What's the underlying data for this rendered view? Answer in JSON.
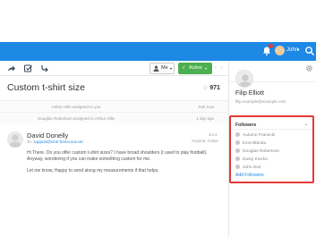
{
  "topbar": {
    "user_name": "John",
    "caret": "▾",
    "icons": [
      "bell-icon",
      "avatar",
      "search-icon"
    ],
    "accent": "#1e88e5"
  },
  "toolbar": {
    "icons": [
      "share-arrow-icon",
      "checkbox-icon",
      "merge-icon"
    ],
    "assignee_label": "Me",
    "assignee_caret": "▾",
    "status_label": "Active",
    "status_check": "✓",
    "status_caret": "▾",
    "status_color": "#4caf50",
    "nav_arrows": "‹ ›"
  },
  "ticket": {
    "title": "Custom t-shirt size",
    "rating_star": "☆",
    "rating_value": "971"
  },
  "events": [
    {
      "text": "Arthur Hills assigned to you",
      "time": "Just now"
    },
    {
      "text": "Douglas Robertson assigned to Arthur Hills",
      "time": "1 day ago"
    }
  ],
  "message": {
    "sender": "David Donelly",
    "to_prefix": "To: ",
    "to_address": "support@smtr.freescout.net",
    "date": "Jul 4",
    "status": "Anyone: Active",
    "body_lines": [
      "Hi There. Do you offer custom t-shirt sizes? I have broad shoulders (I used to play football).",
      "Anyway, wondering if you can make something custom for me.",
      "Let me know, Happy to send along my measurements if that helps."
    ]
  },
  "contact": {
    "name": "Filip Elliott",
    "email": "filip.example@example.com"
  },
  "followers": {
    "title": "Followers",
    "collapse": "▴",
    "items": [
      "Autumn Franecki",
      "Ezra Blanda",
      "Douglas Robertson",
      "Dusty Klocko",
      "John Doe"
    ],
    "add_label": "Add Followers",
    "highlight_color": "#e53935"
  }
}
